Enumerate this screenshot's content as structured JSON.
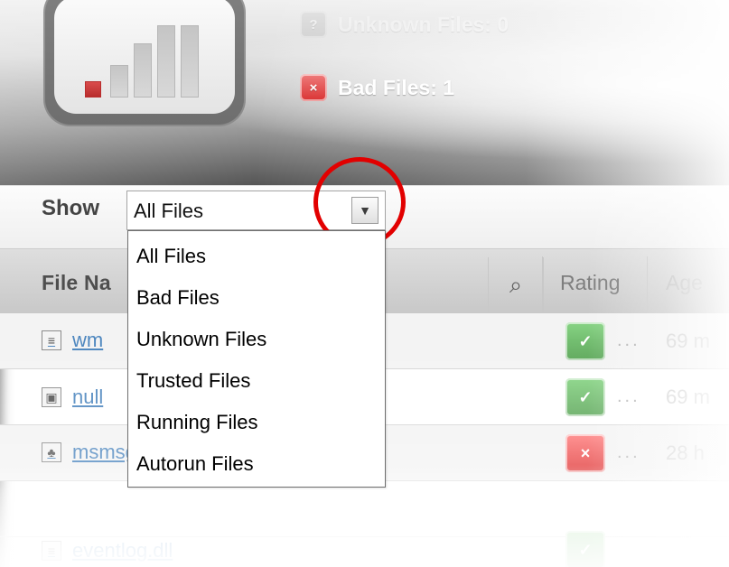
{
  "header": {
    "stats": {
      "unknown": {
        "label": "Unknown Files: 0",
        "icon": "question-icon"
      },
      "bad": {
        "label": "Bad Files: 1",
        "icon": "close-icon"
      }
    }
  },
  "filter": {
    "label": "Show",
    "selected": "All Files",
    "options": [
      "All Files",
      "Bad Files",
      "Unknown Files",
      "Trusted Files",
      "Running Files",
      "Autorun Files"
    ]
  },
  "table": {
    "columns": {
      "file_name": "File Na",
      "rating": "Rating",
      "age": "Age"
    },
    "rows": [
      {
        "name": "wm",
        "icon": "script-file-icon",
        "rating": "trusted",
        "extra": "...",
        "age": "69 m"
      },
      {
        "name": "null",
        "icon": "system-file-icon",
        "rating": "trusted",
        "extra": "...",
        "age": "69 m"
      },
      {
        "name": "msmsgs.exe",
        "icon": "user-group-icon",
        "rating": "bad",
        "extra": "...",
        "age": "28 h"
      },
      {
        "name": "eventlog.dll",
        "icon": "dll-file-icon",
        "rating": "trusted",
        "extra": "",
        "age": ""
      }
    ]
  },
  "colors": {
    "highlight": "#e20000",
    "link": "#4e87bf",
    "trusted": "#5da75a",
    "bad": "#de2a2a"
  }
}
